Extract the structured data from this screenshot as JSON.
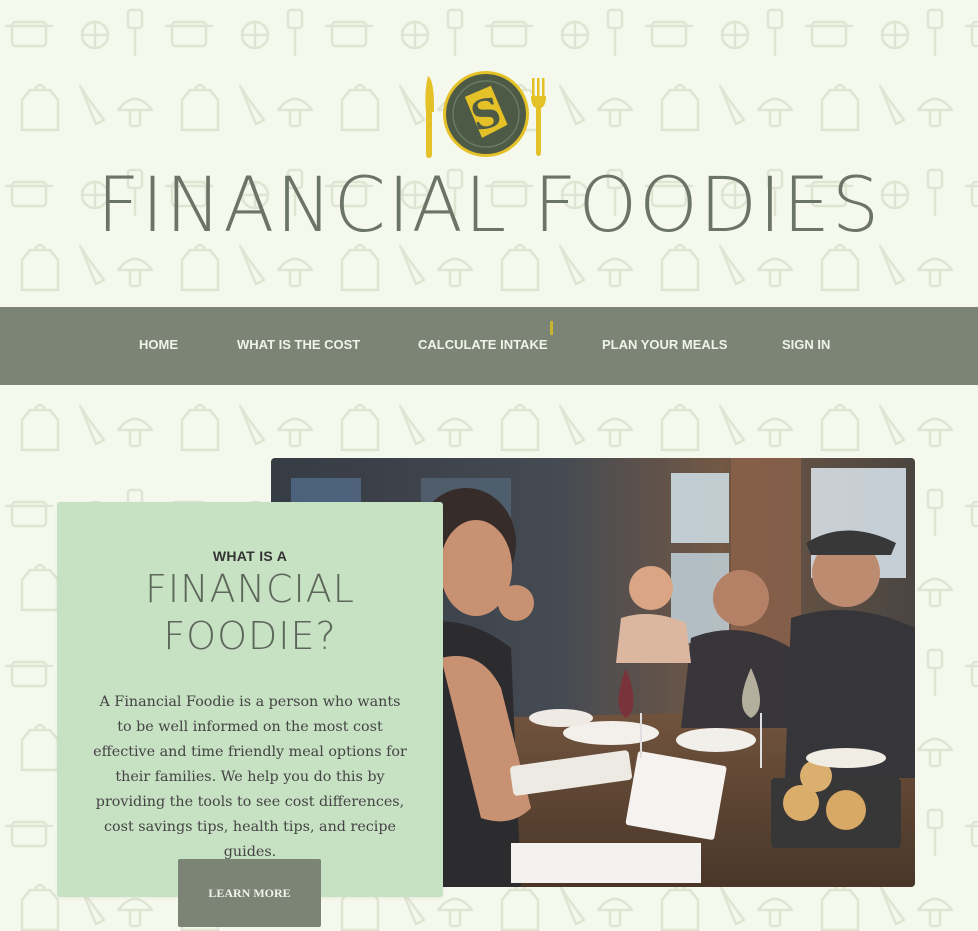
{
  "brand": {
    "title": "FINANCIAL FOODIES",
    "logo_icons": [
      "knife-icon",
      "dollar-plate-icon",
      "fork-icon"
    ]
  },
  "nav": {
    "items": [
      {
        "label": "HOME"
      },
      {
        "label": "WHAT IS THE COST"
      },
      {
        "label": "CALCULATE INTAKE"
      },
      {
        "label": "PLAN YOUR MEALS"
      },
      {
        "label": "SIGN IN"
      }
    ]
  },
  "hero": {
    "kicker": "WHAT IS A",
    "headline_line1": "FINANCIAL",
    "headline_line2": "FOODIE?",
    "body": "A Financial Foodie is a person who wants to be well informed on the most cost effective and time friendly meal options for their families. We help you do this by providing the tools to see cost differences, cost savings tips, health tips, and recipe guides.",
    "button_label": "LEARN MORE",
    "photo_icon": "restaurant-diners-photo"
  },
  "colors": {
    "background": "#f5f8ec",
    "nav": "#7b8475",
    "card": "#c7e1c3",
    "accent": "#e5c128",
    "plate": "#4d5a45"
  }
}
